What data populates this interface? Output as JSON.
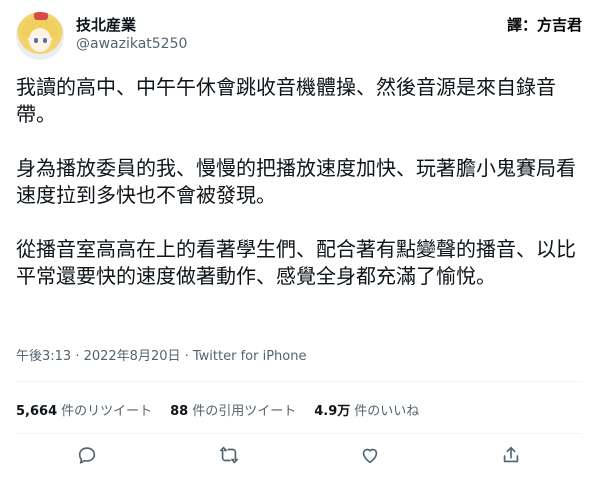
{
  "author": {
    "name": "技北産業",
    "handle": "@awazikat5250"
  },
  "translator_credit": "譯：方吉君",
  "tweet": {
    "paragraphs": [
      "我讀的高中、中午午休會跳收音機體操、然後音源是來自錄音帶。",
      "身為播放委員的我、慢慢的把播放速度加快、玩著膽小鬼賽局看速度拉到多快也不會被發現。",
      "從播音室高高在上的看著學生們、配合著有點變聲的播音、以比平常還要快的速度做著動作、感覺全身都充滿了愉悅。"
    ],
    "timestamp": "午後3:13 · 2022年8月20日 · Twitter for iPhone"
  },
  "stats": {
    "retweets_count": "5,664",
    "retweets_label": "件のリツイート",
    "quotes_count": "88",
    "quotes_label": "件の引用ツイート",
    "likes_count": "4.9万",
    "likes_label": "件のいいね"
  },
  "icons": {
    "reply": "reply-icon",
    "retweet": "retweet-icon",
    "like": "like-icon",
    "share": "share-icon"
  }
}
